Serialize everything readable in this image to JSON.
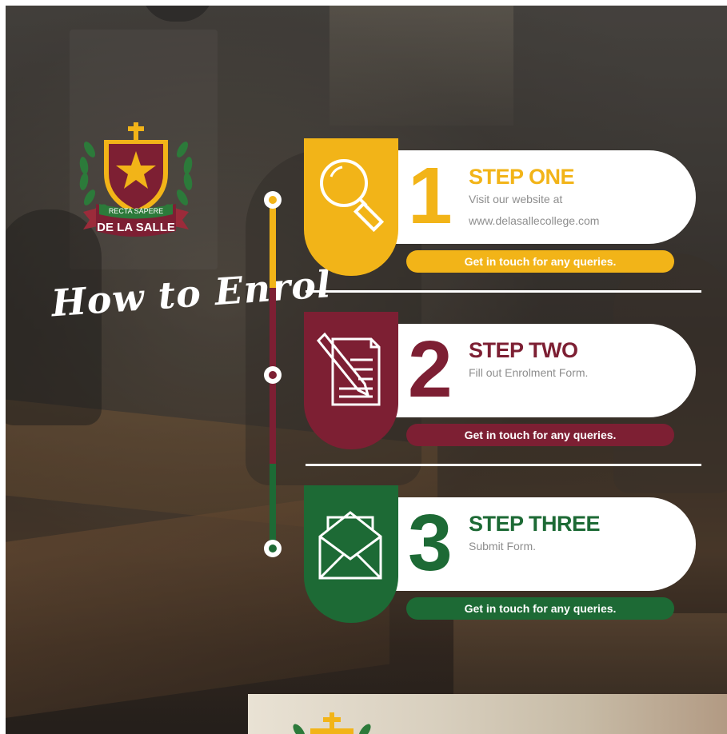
{
  "colors": {
    "yellow": "#f2b418",
    "maroon": "#7d1f33",
    "green": "#1d6a35",
    "card": "#ffffff"
  },
  "crest": {
    "motto": "RECTA SAPERE",
    "name": "DE LA SALLE"
  },
  "heading": "How to Enrol",
  "steps": [
    {
      "number": "1",
      "title": "STEP ONE",
      "desc_line1": "Visit our website at",
      "desc_line2": "www.delasallecollege.com",
      "icon": "magnifying-glass-icon",
      "cta": "Get in touch for any queries."
    },
    {
      "number": "2",
      "title": "STEP TWO",
      "desc_line1": "Fill out Enrolment Form.",
      "icon": "form-pencil-icon",
      "cta": "Get in touch for any queries."
    },
    {
      "number": "3",
      "title": "STEP THREE",
      "desc_line1": "Submit Form.",
      "icon": "envelope-icon",
      "cta": "Get in touch for any queries."
    }
  ]
}
